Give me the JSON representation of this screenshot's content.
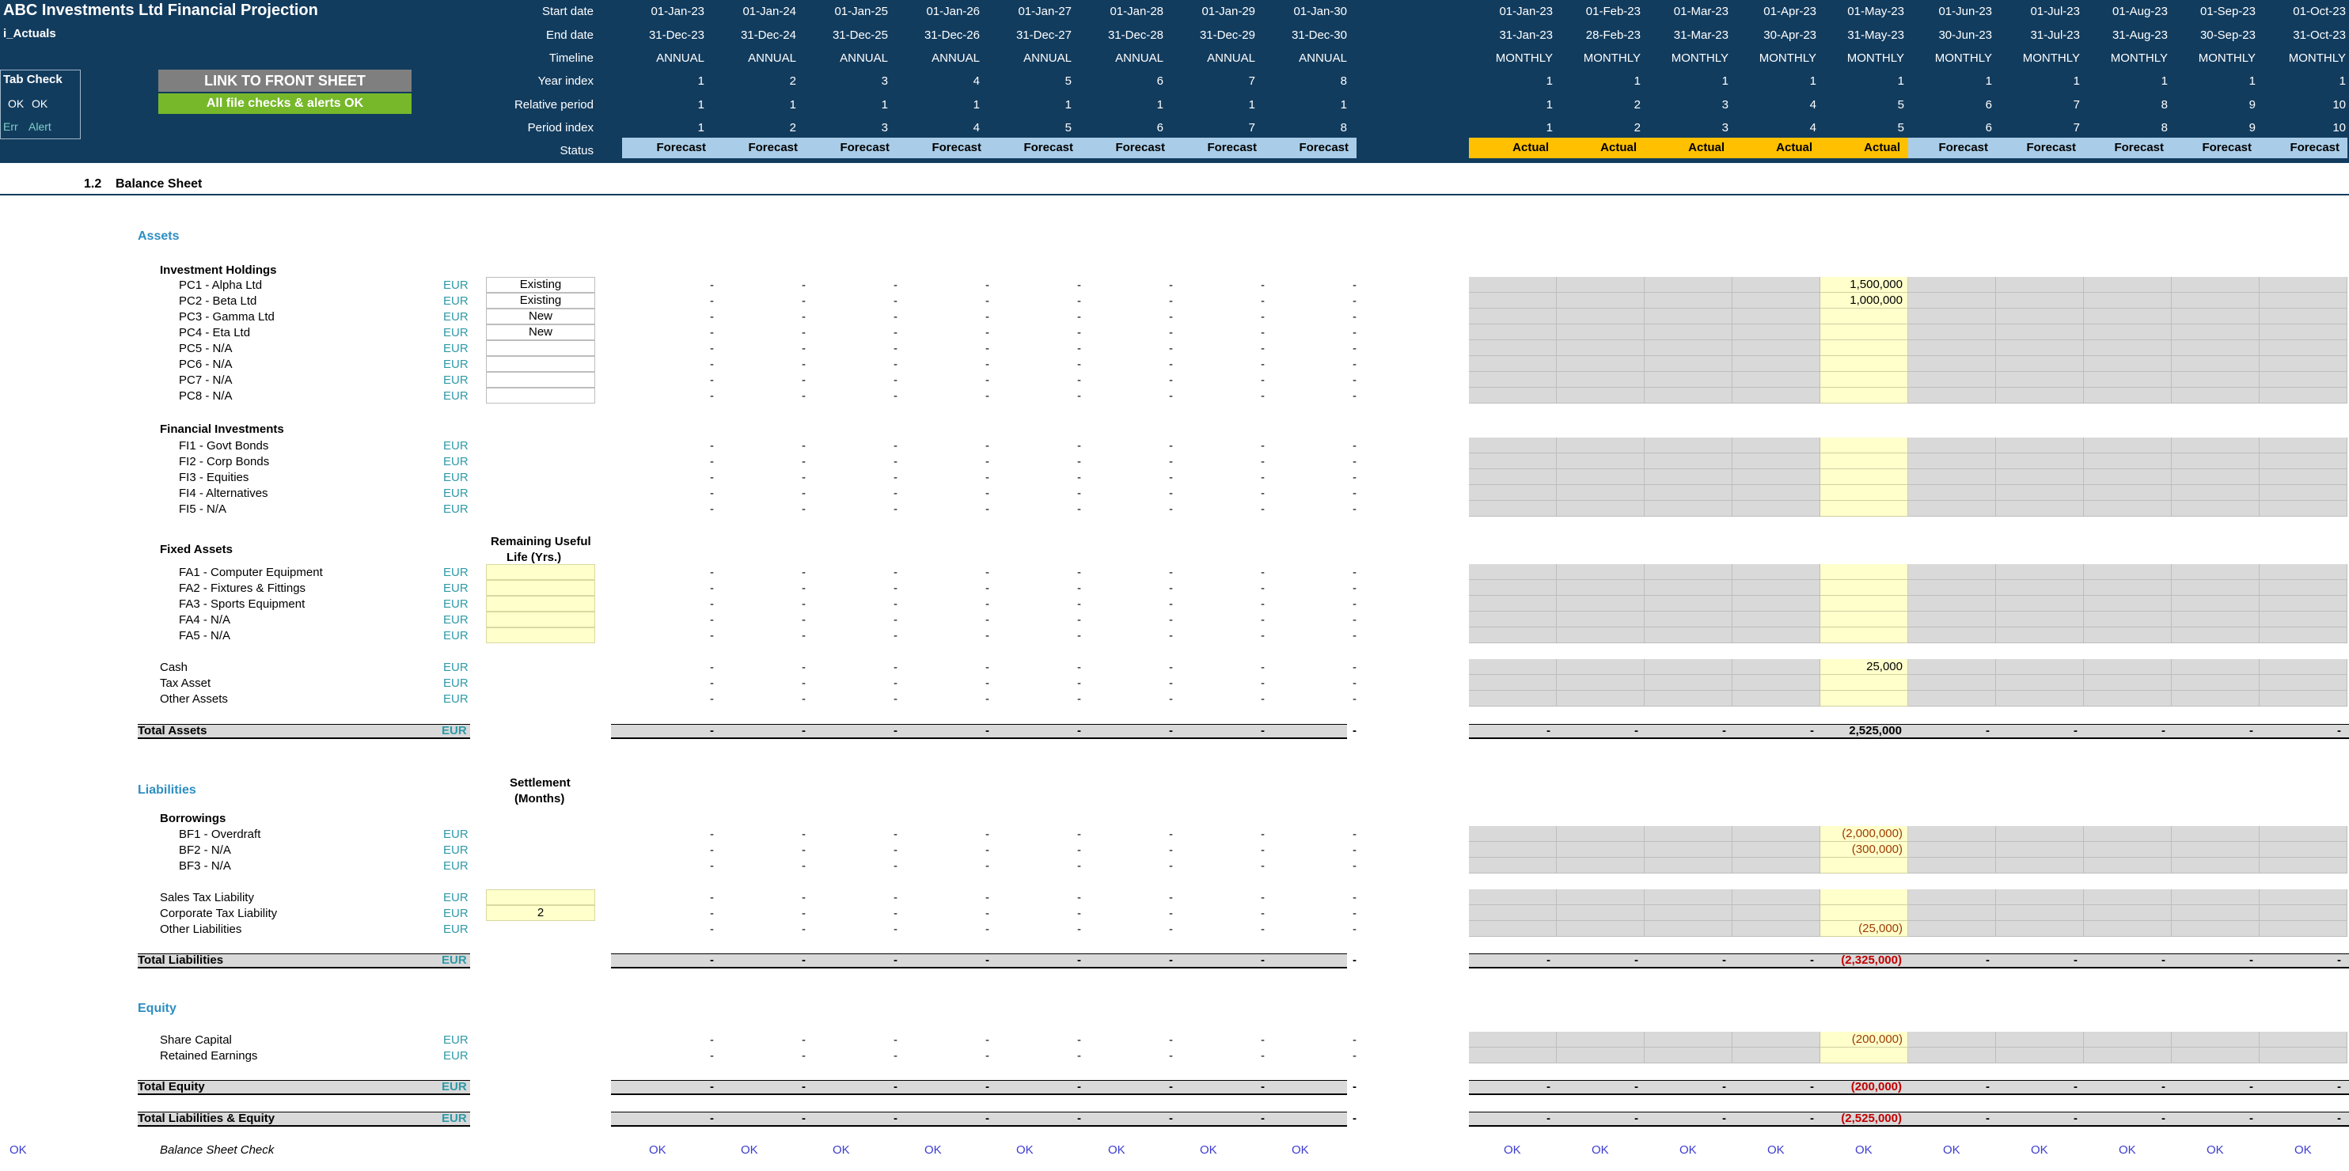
{
  "title": "ABC Investments Ltd Financial Projection",
  "sheet": "i_Actuals",
  "tab_check": {
    "title": "Tab Check",
    "ok1": "OK",
    "ok2": "OK",
    "err": "Err",
    "alert": "Alert"
  },
  "buttons": {
    "front": "LINK TO FRONT SHEET",
    "checks": "All file checks & alerts OK"
  },
  "header_labels": [
    "Start date",
    "End date",
    "Timeline",
    "Year index",
    "Relative period",
    "Period index",
    "Status"
  ],
  "annual": {
    "start": [
      "01-Jan-23",
      "01-Jan-24",
      "01-Jan-25",
      "01-Jan-26",
      "01-Jan-27",
      "01-Jan-28",
      "01-Jan-29",
      "01-Jan-30"
    ],
    "end": [
      "31-Dec-23",
      "31-Dec-24",
      "31-Dec-25",
      "31-Dec-26",
      "31-Dec-27",
      "31-Dec-28",
      "31-Dec-29",
      "31-Dec-30"
    ],
    "timeline": "ANNUAL",
    "year_index": [
      "1",
      "2",
      "3",
      "4",
      "5",
      "6",
      "7",
      "8"
    ],
    "relative": [
      "1",
      "1",
      "1",
      "1",
      "1",
      "1",
      "1",
      "1"
    ],
    "period": [
      "1",
      "2",
      "3",
      "4",
      "5",
      "6",
      "7",
      "8"
    ],
    "status": "Forecast"
  },
  "monthly": {
    "start": [
      "01-Jan-23",
      "01-Feb-23",
      "01-Mar-23",
      "01-Apr-23",
      "01-May-23",
      "01-Jun-23",
      "01-Jul-23",
      "01-Aug-23",
      "01-Sep-23",
      "01-Oct-23"
    ],
    "end": [
      "31-Jan-23",
      "28-Feb-23",
      "31-Mar-23",
      "30-Apr-23",
      "31-May-23",
      "30-Jun-23",
      "31-Jul-23",
      "31-Aug-23",
      "30-Sep-23",
      "31-Oct-23"
    ],
    "timeline": "MONTHLY",
    "year_index": [
      "1",
      "1",
      "1",
      "1",
      "1",
      "1",
      "1",
      "1",
      "1",
      "1"
    ],
    "relative": [
      "1",
      "2",
      "3",
      "4",
      "5",
      "6",
      "7",
      "8",
      "9",
      "10"
    ],
    "period": [
      "1",
      "2",
      "3",
      "4",
      "5",
      "6",
      "7",
      "8",
      "9",
      "10"
    ],
    "status": [
      "Actual",
      "Actual",
      "Actual",
      "Actual",
      "Actual",
      "Forecast",
      "Forecast",
      "Forecast",
      "Forecast",
      "Forecast"
    ]
  },
  "section": {
    "number": "1.2",
    "name": "Balance Sheet"
  },
  "assets": {
    "heading": "Assets",
    "investment_holdings": "Investment Holdings",
    "pc": [
      {
        "name": "PC1 - Alpha Ltd",
        "status": "Existing",
        "may": "1,500,000"
      },
      {
        "name": "PC2 - Beta Ltd",
        "status": "Existing",
        "may": "1,000,000"
      },
      {
        "name": "PC3 - Gamma Ltd",
        "status": "New",
        "may": ""
      },
      {
        "name": "PC4 - Eta Ltd",
        "status": "New",
        "may": ""
      },
      {
        "name": "PC5 - N/A",
        "status": "",
        "may": ""
      },
      {
        "name": "PC6 - N/A",
        "status": "",
        "may": ""
      },
      {
        "name": "PC7 - N/A",
        "status": "",
        "may": ""
      },
      {
        "name": "PC8 - N/A",
        "status": "",
        "may": ""
      }
    ],
    "financial_investments": "Financial Investments",
    "fi": [
      "FI1 - Govt Bonds",
      "FI2 - Corp Bonds",
      "FI3 - Equities",
      "FI4 - Alternatives",
      "FI5 - N/A"
    ],
    "fixed_assets": "Fixed Assets",
    "rul_header1": "Remaining Useful",
    "rul_header2": "Life (Yrs.)",
    "fa": [
      "FA1 - Computer Equipment",
      "FA2 - Fixtures & Fittings",
      "FA3 - Sports Equipment",
      "FA4 - N/A",
      "FA5 - N/A"
    ],
    "cash": "Cash",
    "cash_may": "25,000",
    "tax_asset": "Tax Asset",
    "other_assets": "Other Assets",
    "total": "Total Assets",
    "total_may": "2,525,000"
  },
  "liabilities": {
    "heading": "Liabilities",
    "settle1": "Settlement",
    "settle2": "(Months)",
    "borrowings": "Borrowings",
    "bf": [
      {
        "name": "BF1 - Overdraft",
        "may": "(2,000,000)"
      },
      {
        "name": "BF2 - N/A",
        "may": "(300,000)"
      },
      {
        "name": "BF3 - N/A",
        "may": ""
      }
    ],
    "sales_tax": "Sales Tax Liability",
    "corp_tax": "Corporate Tax Liability",
    "corp_tax_months": "2",
    "other": "Other Liabilities",
    "other_may": "(25,000)",
    "total": "Total Liabilities",
    "total_may": "(2,325,000)"
  },
  "equity": {
    "heading": "Equity",
    "share_capital": "Share Capital",
    "share_capital_may": "(200,000)",
    "retained": "Retained Earnings",
    "total": "Total Equity",
    "total_may": "(200,000)",
    "total_le": "Total Liabilities & Equity",
    "total_le_may": "(2,525,000)"
  },
  "check": {
    "label": "Balance Sheet Check",
    "ok": "OK"
  },
  "currency": "EUR",
  "dash": "-",
  "colors": {
    "header": "#123c5e",
    "forecast": "#a9cde8",
    "actual": "#ffc000",
    "input": "#ffffcc",
    "teal": "#2e8ec2"
  }
}
